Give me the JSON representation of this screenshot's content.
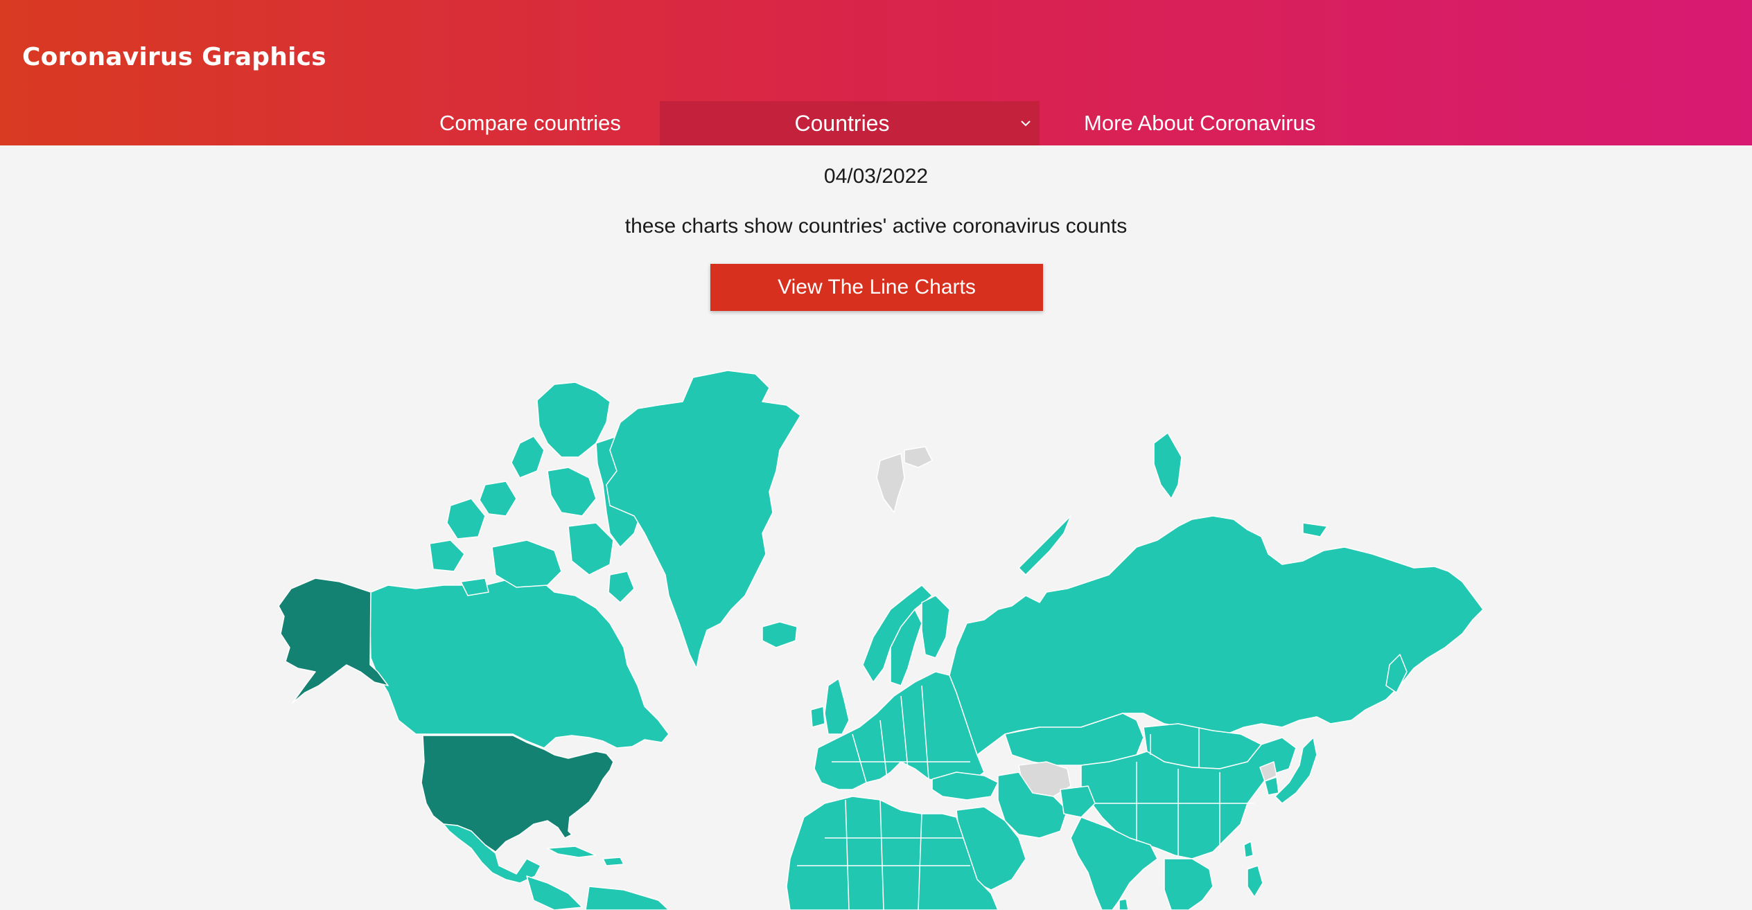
{
  "header": {
    "brand": "Coronavirus Graphics",
    "nav": {
      "compare_label": "Compare countries",
      "countries_label": "Countries",
      "more_label": "More About Coronavirus"
    }
  },
  "main": {
    "date": "04/03/2022",
    "description": "these charts show countries' active coronavirus counts",
    "cta_label": "View The Line Charts"
  },
  "map": {
    "colors": {
      "default": "#22c7b1",
      "highlight": "#138272",
      "no_data": "#d9d9d9",
      "background": "#f4f4f4"
    },
    "highlighted_countries": [
      "United States",
      "Alaska (United States)"
    ],
    "no_data_regions": [
      "Svalbard",
      "Turkmenistan",
      "North Korea"
    ]
  },
  "colors": {
    "header_start": "#d93a22",
    "header_end": "#d81a72",
    "dropdown_bg": "#c4223c",
    "button": "#d8301f"
  }
}
